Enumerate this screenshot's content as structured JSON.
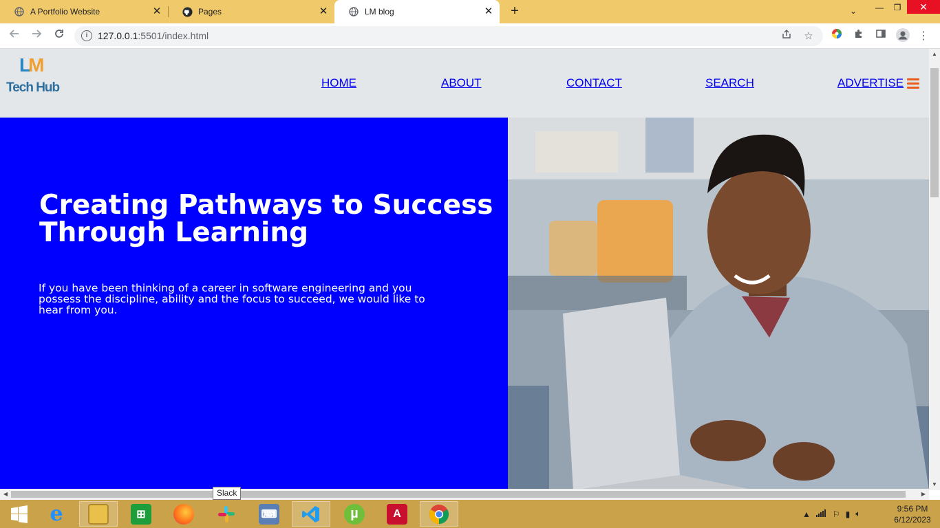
{
  "browser": {
    "tabs": [
      {
        "title": "A Portfolio Website",
        "icon": "globe-icon"
      },
      {
        "title": "Pages",
        "icon": "github-icon"
      },
      {
        "title": "LM blog",
        "icon": "globe-icon",
        "active": true
      }
    ],
    "url_host": "127.0.0.1",
    "url_path": ":5501/index.html"
  },
  "site": {
    "logo_top": "LM",
    "logo_bottom": "Tech Hub",
    "nav": [
      {
        "label": "HOME"
      },
      {
        "label": "ABOUT"
      },
      {
        "label": "CONTACT"
      },
      {
        "label": "SEARCH"
      },
      {
        "label": "ADVERTISE"
      }
    ],
    "hero_title": "Creating Pathways to Success Through Learning",
    "hero_text": "If you have been thinking of a career in software engineering and you possess the discipline, ability and the focus to succeed, we would like to hear from you."
  },
  "taskbar": {
    "tooltip": "Slack",
    "apps": [
      "internet-explorer",
      "file-explorer",
      "store",
      "firefox",
      "slack",
      "keyboard",
      "vscode",
      "utorrent",
      "adobe-reader",
      "chrome"
    ],
    "time": "9:56 PM",
    "date": "6/12/2023"
  },
  "colors": {
    "hero_blue": "#0000ff",
    "tab_strip": "#f0c96b",
    "taskbar": "#c9a24a",
    "link": "#0000ee",
    "hamburger": "#e85d1a"
  }
}
